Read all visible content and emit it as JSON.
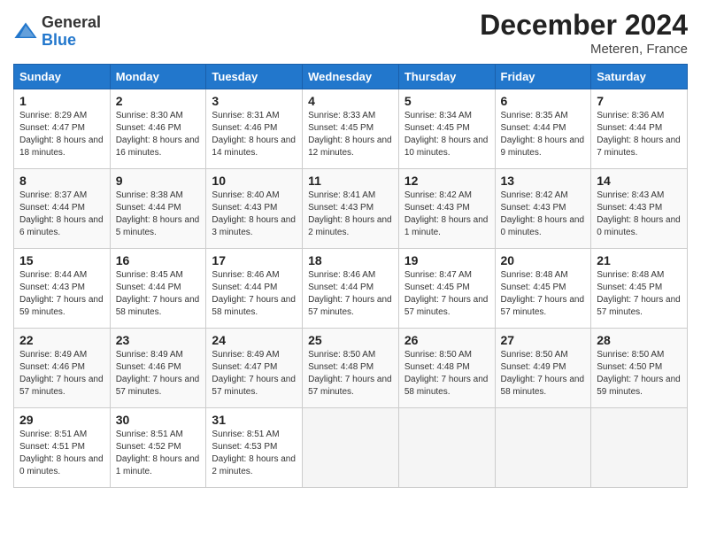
{
  "logo": {
    "general": "General",
    "blue": "Blue"
  },
  "title": "December 2024",
  "location": "Meteren, France",
  "days_of_week": [
    "Sunday",
    "Monday",
    "Tuesday",
    "Wednesday",
    "Thursday",
    "Friday",
    "Saturday"
  ],
  "weeks": [
    [
      {
        "day": "1",
        "sunrise": "8:29 AM",
        "sunset": "4:47 PM",
        "daylight": "8 hours and 18 minutes."
      },
      {
        "day": "2",
        "sunrise": "8:30 AM",
        "sunset": "4:46 PM",
        "daylight": "8 hours and 16 minutes."
      },
      {
        "day": "3",
        "sunrise": "8:31 AM",
        "sunset": "4:46 PM",
        "daylight": "8 hours and 14 minutes."
      },
      {
        "day": "4",
        "sunrise": "8:33 AM",
        "sunset": "4:45 PM",
        "daylight": "8 hours and 12 minutes."
      },
      {
        "day": "5",
        "sunrise": "8:34 AM",
        "sunset": "4:45 PM",
        "daylight": "8 hours and 10 minutes."
      },
      {
        "day": "6",
        "sunrise": "8:35 AM",
        "sunset": "4:44 PM",
        "daylight": "8 hours and 9 minutes."
      },
      {
        "day": "7",
        "sunrise": "8:36 AM",
        "sunset": "4:44 PM",
        "daylight": "8 hours and 7 minutes."
      }
    ],
    [
      {
        "day": "8",
        "sunrise": "8:37 AM",
        "sunset": "4:44 PM",
        "daylight": "8 hours and 6 minutes."
      },
      {
        "day": "9",
        "sunrise": "8:38 AM",
        "sunset": "4:44 PM",
        "daylight": "8 hours and 5 minutes."
      },
      {
        "day": "10",
        "sunrise": "8:40 AM",
        "sunset": "4:43 PM",
        "daylight": "8 hours and 3 minutes."
      },
      {
        "day": "11",
        "sunrise": "8:41 AM",
        "sunset": "4:43 PM",
        "daylight": "8 hours and 2 minutes."
      },
      {
        "day": "12",
        "sunrise": "8:42 AM",
        "sunset": "4:43 PM",
        "daylight": "8 hours and 1 minute."
      },
      {
        "day": "13",
        "sunrise": "8:42 AM",
        "sunset": "4:43 PM",
        "daylight": "8 hours and 0 minutes."
      },
      {
        "day": "14",
        "sunrise": "8:43 AM",
        "sunset": "4:43 PM",
        "daylight": "8 hours and 0 minutes."
      }
    ],
    [
      {
        "day": "15",
        "sunrise": "8:44 AM",
        "sunset": "4:43 PM",
        "daylight": "7 hours and 59 minutes."
      },
      {
        "day": "16",
        "sunrise": "8:45 AM",
        "sunset": "4:44 PM",
        "daylight": "7 hours and 58 minutes."
      },
      {
        "day": "17",
        "sunrise": "8:46 AM",
        "sunset": "4:44 PM",
        "daylight": "7 hours and 58 minutes."
      },
      {
        "day": "18",
        "sunrise": "8:46 AM",
        "sunset": "4:44 PM",
        "daylight": "7 hours and 57 minutes."
      },
      {
        "day": "19",
        "sunrise": "8:47 AM",
        "sunset": "4:45 PM",
        "daylight": "7 hours and 57 minutes."
      },
      {
        "day": "20",
        "sunrise": "8:48 AM",
        "sunset": "4:45 PM",
        "daylight": "7 hours and 57 minutes."
      },
      {
        "day": "21",
        "sunrise": "8:48 AM",
        "sunset": "4:45 PM",
        "daylight": "7 hours and 57 minutes."
      }
    ],
    [
      {
        "day": "22",
        "sunrise": "8:49 AM",
        "sunset": "4:46 PM",
        "daylight": "7 hours and 57 minutes."
      },
      {
        "day": "23",
        "sunrise": "8:49 AM",
        "sunset": "4:46 PM",
        "daylight": "7 hours and 57 minutes."
      },
      {
        "day": "24",
        "sunrise": "8:49 AM",
        "sunset": "4:47 PM",
        "daylight": "7 hours and 57 minutes."
      },
      {
        "day": "25",
        "sunrise": "8:50 AM",
        "sunset": "4:48 PM",
        "daylight": "7 hours and 57 minutes."
      },
      {
        "day": "26",
        "sunrise": "8:50 AM",
        "sunset": "4:48 PM",
        "daylight": "7 hours and 58 minutes."
      },
      {
        "day": "27",
        "sunrise": "8:50 AM",
        "sunset": "4:49 PM",
        "daylight": "7 hours and 58 minutes."
      },
      {
        "day": "28",
        "sunrise": "8:50 AM",
        "sunset": "4:50 PM",
        "daylight": "7 hours and 59 minutes."
      }
    ],
    [
      {
        "day": "29",
        "sunrise": "8:51 AM",
        "sunset": "4:51 PM",
        "daylight": "8 hours and 0 minutes."
      },
      {
        "day": "30",
        "sunrise": "8:51 AM",
        "sunset": "4:52 PM",
        "daylight": "8 hours and 1 minute."
      },
      {
        "day": "31",
        "sunrise": "8:51 AM",
        "sunset": "4:53 PM",
        "daylight": "8 hours and 2 minutes."
      },
      null,
      null,
      null,
      null
    ]
  ],
  "labels": {
    "sunrise": "Sunrise:",
    "sunset": "Sunset:",
    "daylight": "Daylight:"
  }
}
